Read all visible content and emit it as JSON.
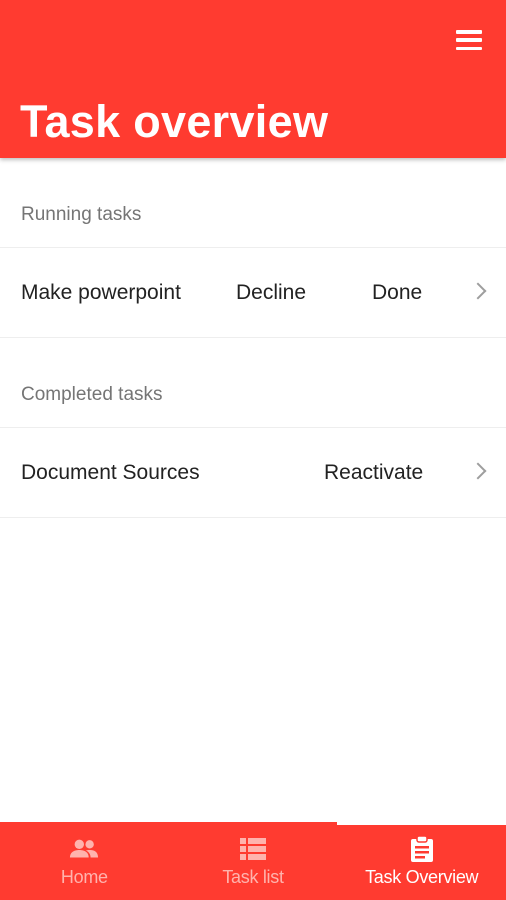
{
  "header": {
    "title": "Task overview",
    "menu_icon": "hamburger-menu-icon"
  },
  "sections": {
    "running": {
      "label": "Running tasks",
      "tasks": [
        {
          "name": "Make powerpoint",
          "actions": [
            "Decline",
            "Done"
          ]
        }
      ]
    },
    "completed": {
      "label": "Completed tasks",
      "tasks": [
        {
          "name": "Document Sources",
          "actions": [
            "Reactivate"
          ]
        }
      ]
    }
  },
  "bottom_nav": {
    "items": [
      {
        "label": "Home",
        "icon": "people-icon",
        "active": false
      },
      {
        "label": "Task list",
        "icon": "list-icon",
        "active": false
      },
      {
        "label": "Task Overview",
        "icon": "clipboard-icon",
        "active": true
      }
    ]
  },
  "colors": {
    "accent": "#ff3b30",
    "inactive_nav": "#ffb3ad",
    "section_label": "#757575",
    "text": "#222222"
  }
}
